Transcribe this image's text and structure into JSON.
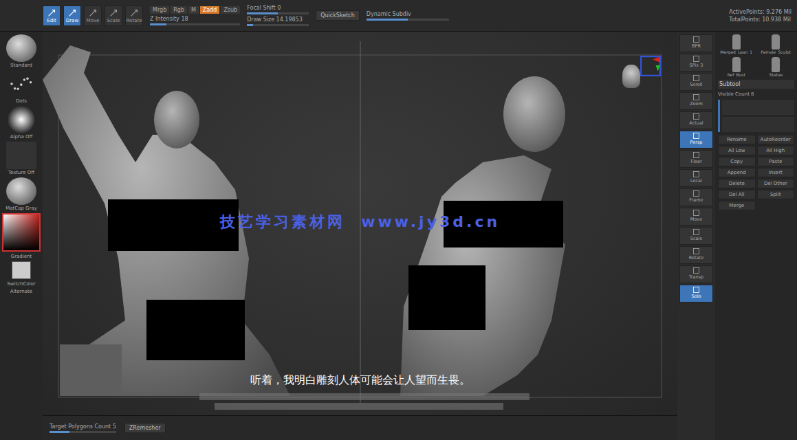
{
  "top_bar": {
    "tools": [
      {
        "label": "Edit",
        "selected": true
      },
      {
        "label": "Draw",
        "selected": true
      },
      {
        "label": "Move",
        "selected": false
      },
      {
        "label": "Scale",
        "selected": false
      },
      {
        "label": "Rotate",
        "selected": false
      }
    ],
    "modes": [
      {
        "label": "Mrgb",
        "selected": false
      },
      {
        "label": "Rgb",
        "selected": false
      },
      {
        "label": "M",
        "selected": false
      },
      {
        "label": "Zadd",
        "selected": true
      },
      {
        "label": "Zsub",
        "selected": false
      }
    ],
    "sliders": [
      {
        "label": "Z Intensity 18",
        "level": 0.18
      },
      {
        "label": "Focal Shift 0",
        "level": 0.5
      },
      {
        "label": "Draw Size 14.19853",
        "level": 0.1
      }
    ],
    "quick_button": "QuickSketch",
    "subdiv_slider": {
      "label": "Dynamic Subdiv",
      "level": 0.5
    },
    "stats": [
      "ActivePoints: 9.276 Mil",
      "TotalPoints: 10.938 Mil"
    ]
  },
  "left_panel": {
    "items": [
      {
        "label": "Standard",
        "kind": "brush"
      },
      {
        "label": "Dots",
        "kind": "stroke"
      },
      {
        "label": "Alpha Off",
        "kind": "alpha"
      },
      {
        "label": "Texture Off",
        "kind": "texture"
      },
      {
        "label": "MatCap Gray",
        "kind": "material"
      }
    ],
    "color_label": "Gradient",
    "switch_label": "SwitchColor",
    "alternate_label": "Alternate"
  },
  "viewport": {
    "watermark": "技艺学习素材网  www.jy3d.cn",
    "subtitle": "听着，我明白雕刻人体可能会让人望而生畏。"
  },
  "bottom_bar": {
    "label": "Target Polygons Count 5",
    "level": 0.3,
    "button": "ZRemesher"
  },
  "shelf": [
    {
      "label": "BPR",
      "selected": false
    },
    {
      "label": "SPix 3",
      "selected": false
    },
    {
      "label": "Scroll",
      "selected": false
    },
    {
      "label": "Zoom",
      "selected": false
    },
    {
      "label": "Actual",
      "selected": false
    },
    {
      "label": "Persp",
      "selected": true
    },
    {
      "label": "Floor",
      "selected": false
    },
    {
      "label": "Local",
      "selected": false
    },
    {
      "label": "Frame",
      "selected": false
    },
    {
      "label": "Move",
      "selected": false
    },
    {
      "label": "Scale",
      "selected": false
    },
    {
      "label": "Rotate",
      "selected": false
    },
    {
      "label": "Transp",
      "selected": false
    },
    {
      "label": "Solo",
      "selected": true
    }
  ],
  "right_panel": {
    "tools": [
      "Merged_Lean_1",
      "Female_Sculpt",
      "Ref_Bust",
      "Statue"
    ],
    "header": "Subtool",
    "visible": "Visible Count 8",
    "buttons": [
      "Rename",
      "AutoReorder",
      "All Low",
      "All High",
      "Copy",
      "Paste",
      "Append",
      "Insert",
      "Delete",
      "Del Other",
      "Del All",
      "Split",
      "Merge"
    ]
  }
}
